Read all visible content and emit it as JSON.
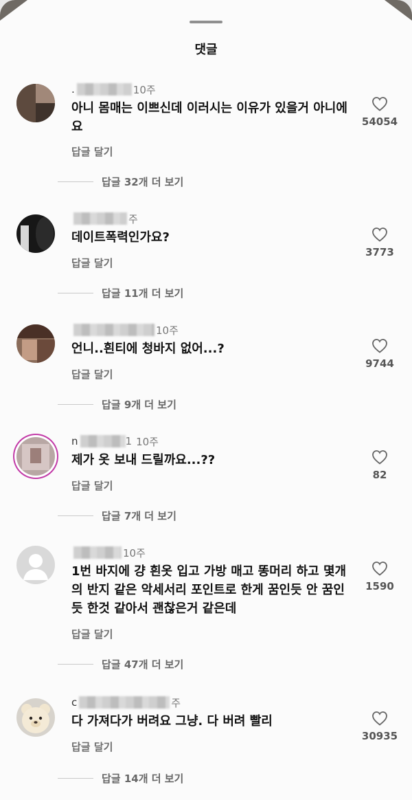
{
  "header": {
    "title": "댓글"
  },
  "reply_label": "답글 달기",
  "comments": [
    {
      "username": ".",
      "time": "10주",
      "text": "아니 몸매는 이쁘신데 이러시는 이유가 있을거 아니에요",
      "likes": "54054",
      "view_replies": "답글 32개 더 보기",
      "avatar": "photo-avatar"
    },
    {
      "username": "",
      "time": "주",
      "text": "데이트폭력인가요?",
      "likes": "3773",
      "view_replies": "답글 11개 더 보기",
      "avatar": "dark-avatar"
    },
    {
      "username": "",
      "time": "10주",
      "text": "언니..흰티에 청바지 없어...?",
      "likes": "9744",
      "view_replies": "답글 9개 더 보기",
      "avatar": "photo-avatar"
    },
    {
      "username": "n",
      "time": "10주",
      "text": "제가 옷 보내 드릴까요...??",
      "likes": "82",
      "view_replies": "답글 7개 더 보기",
      "avatar": "story-avatar"
    },
    {
      "username": "",
      "time": "10주",
      "text": "1번 바지에 걍 흰옷 입고 가방 매고 똥머리 하고 몇개의 반지 같은 악세서리 포인트로 한게 꿈인듯 안 꿈인듯 한것 같아서 괜찮은거 같은데",
      "likes": "1590",
      "view_replies": "답글 47개 더 보기",
      "avatar": "default-avatar"
    },
    {
      "username": "c",
      "time": "주",
      "text": "다 가져다가 버려요 그냥. 다 버려 빨리",
      "likes": "30935",
      "view_replies": "답글 14개 더 보기",
      "avatar": "bear-avatar"
    }
  ]
}
